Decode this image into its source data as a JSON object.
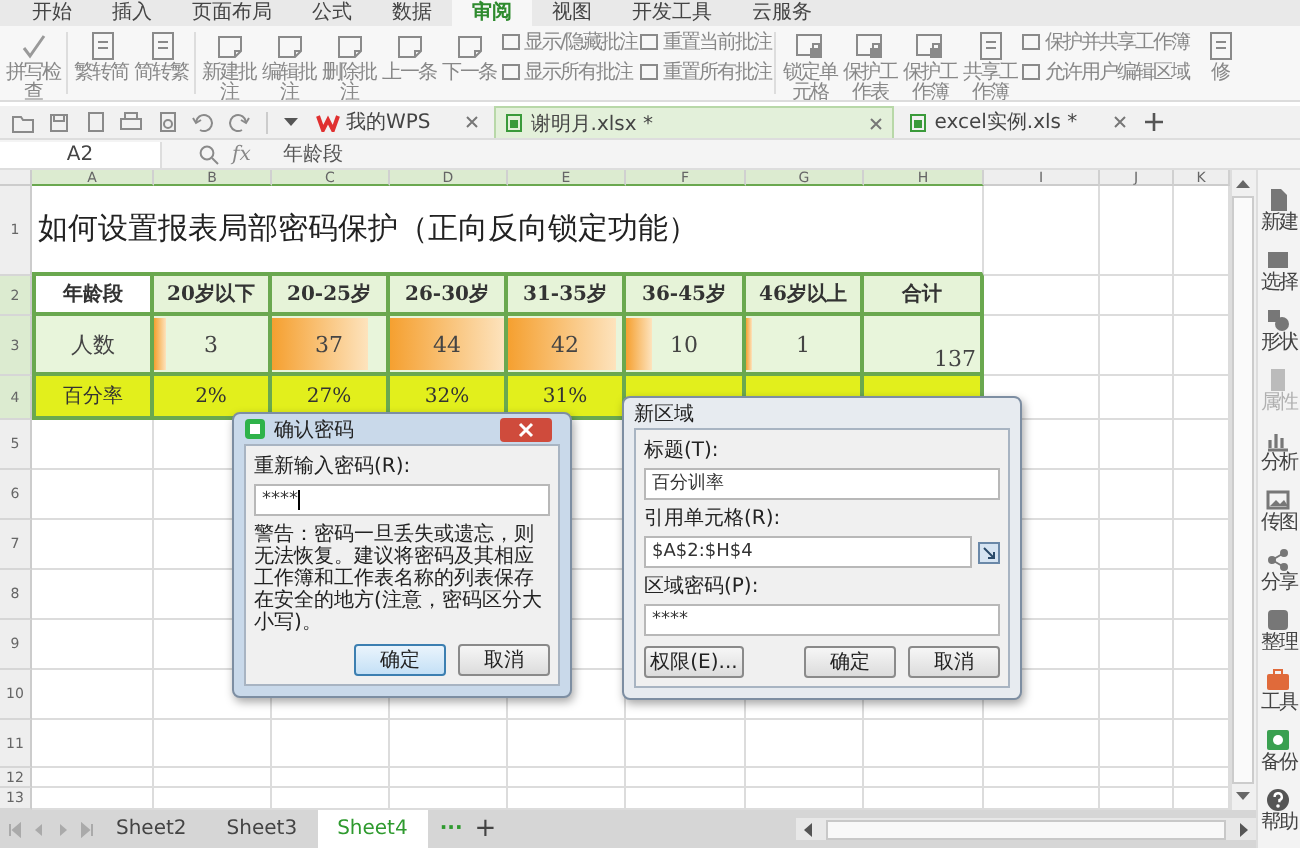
{
  "menu_tabs": [
    {
      "label": "开始",
      "selected": false
    },
    {
      "label": "插入",
      "selected": false
    },
    {
      "label": "页面布局",
      "selected": false
    },
    {
      "label": "公式",
      "selected": false
    },
    {
      "label": "数据",
      "selected": false
    },
    {
      "label": "审阅",
      "selected": true
    },
    {
      "label": "视图",
      "selected": false
    },
    {
      "label": "开发工具",
      "selected": false
    },
    {
      "label": "云服务",
      "selected": false
    }
  ],
  "ribbon": {
    "groups": [
      {
        "items": [
          {
            "kind": "large",
            "label": "拼写检查"
          }
        ]
      },
      {
        "items": [
          {
            "kind": "large",
            "label": "繁转简"
          },
          {
            "kind": "large",
            "label": "简转繁"
          }
        ]
      },
      {
        "items": [
          {
            "kind": "large",
            "label": "新建批注"
          },
          {
            "kind": "large",
            "label": "编辑批注"
          },
          {
            "kind": "large",
            "label": "删除批注"
          },
          {
            "kind": "large",
            "label": "上一条"
          },
          {
            "kind": "large",
            "label": "下一条"
          },
          {
            "kind": "small",
            "label": "显示/隐藏批注"
          },
          {
            "kind": "small",
            "label": "显示所有批注"
          },
          {
            "kind": "small",
            "label": "重置当前批注"
          },
          {
            "kind": "small",
            "label": "重置所有批注"
          }
        ]
      },
      {
        "items": [
          {
            "kind": "large",
            "label": "锁定单元格"
          },
          {
            "kind": "large",
            "label": "保护工作表"
          },
          {
            "kind": "large",
            "label": "保护工作簿"
          },
          {
            "kind": "large",
            "label": "共享工作簿"
          },
          {
            "kind": "small",
            "label": "保护并共享工作簿"
          },
          {
            "kind": "small",
            "label": "允许用户编辑区域"
          },
          {
            "kind": "large",
            "label": "修"
          }
        ]
      }
    ]
  },
  "doc_tabs": [
    {
      "label": "我的WPS",
      "selected": false
    },
    {
      "label": "谢明月.xlsx *",
      "selected": true
    },
    {
      "label": "excel实例.xls *",
      "selected": false
    }
  ],
  "formula_bar": {
    "cell_ref": "A2",
    "fx": "fx",
    "value": "年龄段"
  },
  "sheet": {
    "columns": [
      "A",
      "B",
      "C",
      "D",
      "E",
      "F",
      "G",
      "H",
      "I",
      "J",
      "K"
    ],
    "rows": [
      {
        "header": "1",
        "kind": "title",
        "text": "如何设置报表局部密码保护（正向反向锁定功能）"
      },
      {
        "header": "2",
        "kind": "header",
        "cells": [
          "年龄段",
          "20岁以下",
          "20-25岁",
          "26-30岁",
          "31-35岁",
          "36-45岁",
          "46岁以上",
          "合计"
        ]
      },
      {
        "header": "3",
        "kind": "count",
        "cells": [
          {
            "text": "人数"
          },
          {
            "text": "3",
            "level": 0.1
          },
          {
            "text": "37",
            "level": 0.84
          },
          {
            "text": "44",
            "level": 1
          },
          {
            "text": "42",
            "level": 0.95
          },
          {
            "text": "10",
            "level": 0.23
          },
          {
            "text": "1",
            "level": 0.05
          },
          {
            "text": "137"
          }
        ]
      },
      {
        "header": "4",
        "kind": "percent",
        "cells": [
          "百分率",
          "2%",
          "27%",
          "32%",
          "31%"
        ]
      },
      {
        "header": "5",
        "kind": "empty"
      },
      {
        "header": "6",
        "kind": "empty"
      },
      {
        "header": "7",
        "kind": "empty"
      },
      {
        "header": "8",
        "kind": "empty"
      },
      {
        "header": "9",
        "kind": "empty"
      },
      {
        "header": "10",
        "kind": "empty"
      },
      {
        "header": "11",
        "kind": "empty"
      },
      {
        "header": "12",
        "kind": "empty"
      },
      {
        "header": "13",
        "kind": "empty"
      }
    ]
  },
  "confirm_dialog": {
    "title": "确认密码",
    "field_label": "重新输入密码(R):",
    "value": "****",
    "warning": "警告：密码一旦丢失或遗忘，则无法恢复。建议将密码及其相应工作簿和工作表名称的列表保存在安全的地方(注意，密码区分大小写)。",
    "buttons": [
      "确定",
      "取消"
    ]
  },
  "range_dialog": {
    "title": "新区域",
    "fields": [
      {
        "label": "标题(T):",
        "value": "百分训率"
      },
      {
        "label": "引用单元格(R):",
        "value": "$A$2:$H$4",
        "picker": true
      },
      {
        "label": "区域密码(P):",
        "value": "****"
      }
    ],
    "buttons": [
      "权限(E)...",
      "确定",
      "取消"
    ]
  },
  "sidebar": [
    {
      "label": "新建",
      "disabled": false
    },
    {
      "label": "选择",
      "disabled": false
    },
    {
      "label": "形状",
      "disabled": false
    },
    {
      "label": "属性",
      "disabled": true
    },
    {
      "label": "分析",
      "disabled": false
    },
    {
      "label": "传图",
      "disabled": false
    },
    {
      "label": "分享",
      "disabled": false
    },
    {
      "label": "整理",
      "disabled": false
    },
    {
      "label": "工具",
      "disabled": false
    },
    {
      "label": "备份",
      "disabled": false
    },
    {
      "label": "帮助",
      "disabled": false
    }
  ],
  "sheet_tabs": [
    {
      "label": "Sheet2",
      "selected": false
    },
    {
      "label": "Sheet3",
      "selected": false
    },
    {
      "label": "Sheet4",
      "selected": true
    }
  ],
  "sheet_more": "···",
  "sheet_add": "+"
}
